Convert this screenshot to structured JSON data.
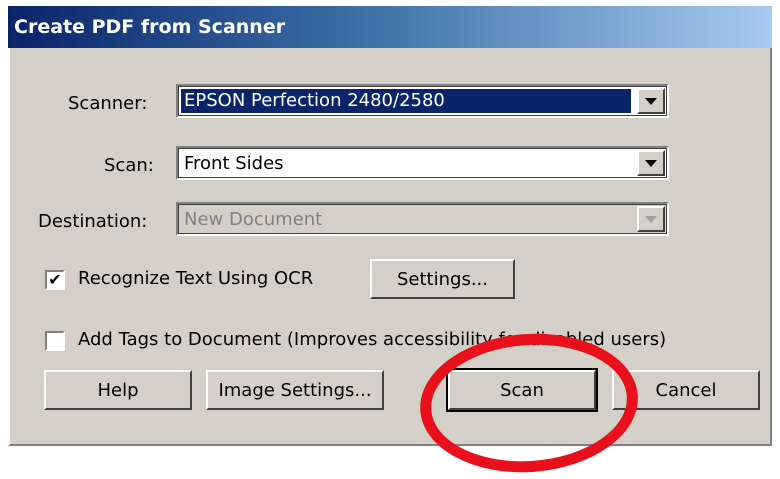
{
  "dialog": {
    "title": "Create PDF from Scanner"
  },
  "scanner": {
    "label": "Scanner:",
    "value": "EPSON Perfection 2480/2580"
  },
  "scan": {
    "label": "Scan:",
    "value": "Front Sides"
  },
  "destination": {
    "label": "Destination:",
    "value": "New Document",
    "disabled": true
  },
  "ocr": {
    "label": "Recognize Text Using OCR",
    "checked": true,
    "check_glyph": "✔",
    "settings_label": "Settings..."
  },
  "tags": {
    "label": "Add Tags to Document (Improves accessibility for disabled users)",
    "checked": false
  },
  "buttons": {
    "help": "Help",
    "image_settings": "Image Settings...",
    "scan": "Scan",
    "cancel": "Cancel"
  },
  "annotation": {
    "shape": "ellipse",
    "color": "#e8101a",
    "target": "Scan"
  },
  "colors": {
    "dialog_bg": "#d4d0c8",
    "title_start": "#0a246a",
    "title_end": "#a6caf0",
    "selection": "#0a246a"
  }
}
